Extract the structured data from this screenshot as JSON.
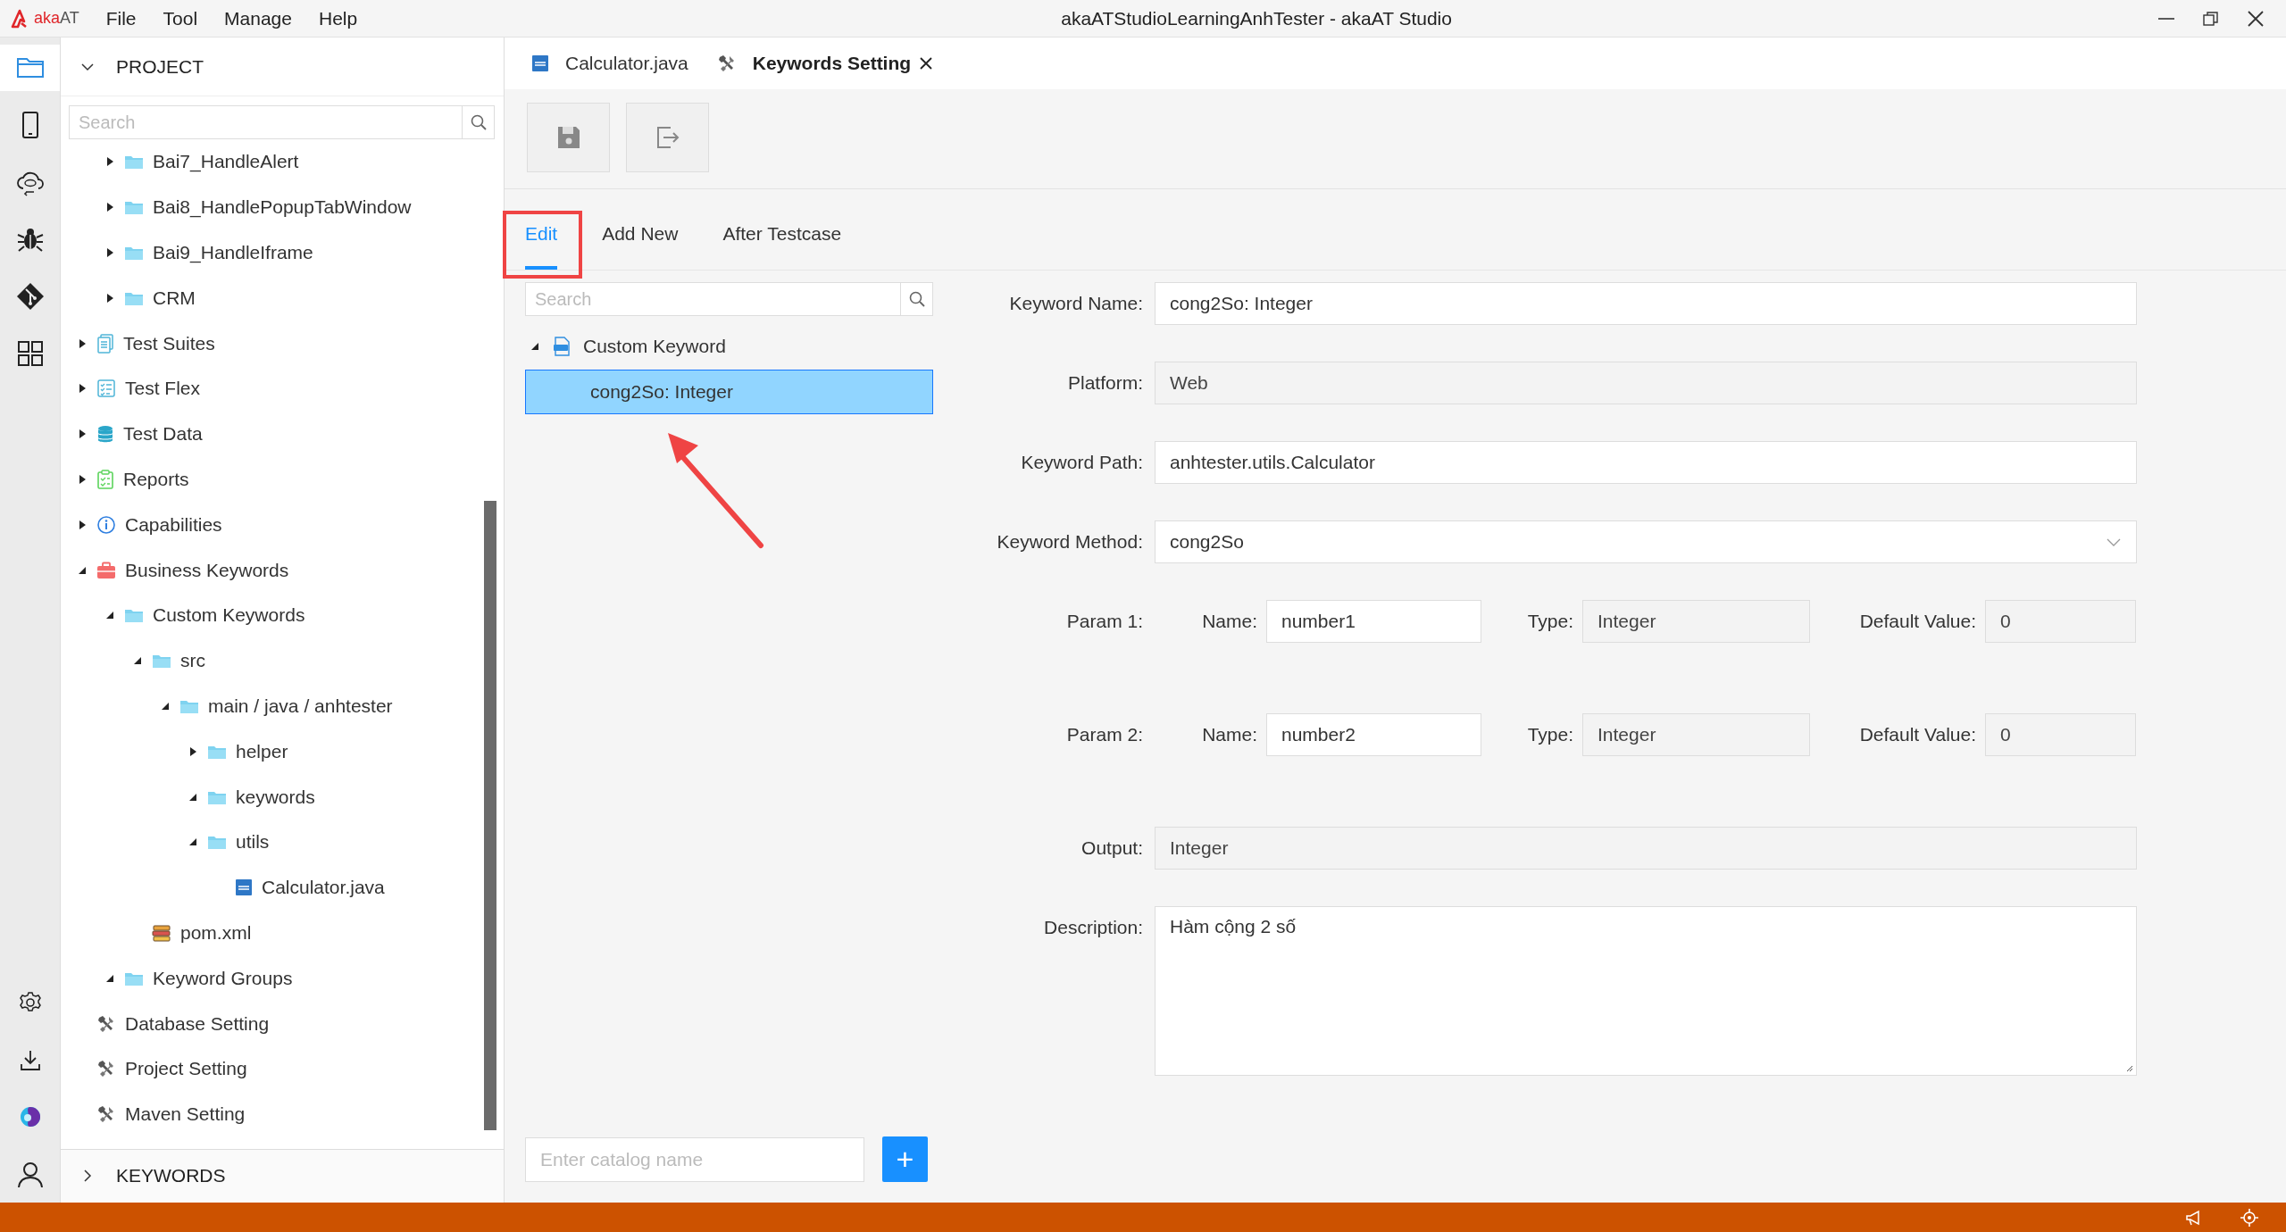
{
  "titlebar": {
    "logo": {
      "prefix": "aka",
      "suffix": "AT"
    },
    "menu": [
      "File",
      "Tool",
      "Manage",
      "Help"
    ],
    "title": "akaATStudioLearningAnhTester - akaAT Studio"
  },
  "activity_bar": {
    "top": [
      {
        "kind": "project",
        "selected": true
      },
      {
        "kind": "mobile",
        "selected": false
      },
      {
        "kind": "api",
        "selected": false
      },
      {
        "kind": "debug",
        "selected": false
      },
      {
        "kind": "git",
        "selected": false
      },
      {
        "kind": "apps",
        "selected": false
      }
    ],
    "bottom": [
      {
        "kind": "settings",
        "selected": false
      },
      {
        "kind": "download",
        "selected": false
      },
      {
        "kind": "brand",
        "selected": false
      },
      {
        "kind": "account",
        "selected": false
      }
    ]
  },
  "sidebar": {
    "header": "PROJECT",
    "expanded": true,
    "search": {
      "placeholder": "Search"
    },
    "tree": {
      "scrolled_group": [
        {
          "label": "Bai7_HandleAlert",
          "kind": "folder",
          "expanded": false
        },
        {
          "label": "Bai8_HandlePopupTabWindow",
          "kind": "folder",
          "expanded": false
        },
        {
          "label": "Bai9_HandleIframe",
          "kind": "folder",
          "expanded": false
        },
        {
          "label": "CRM",
          "kind": "folder",
          "expanded": false
        }
      ],
      "items": [
        {
          "label": "Test Suites",
          "kind": "test-suites",
          "expanded": false
        },
        {
          "label": "Test Flex",
          "kind": "test-flex",
          "expanded": false
        },
        {
          "label": "Test Data",
          "kind": "test-data",
          "expanded": false
        },
        {
          "label": "Reports",
          "kind": "reports",
          "expanded": false
        },
        {
          "label": "Capabilities",
          "kind": "capabilities",
          "expanded": false
        },
        {
          "label": "Business Keywords",
          "kind": "business-keywords",
          "expanded": true,
          "children": [
            {
              "label": "Custom Keywords",
              "kind": "folder",
              "expanded": true,
              "children": [
                {
                  "label": "src",
                  "kind": "folder",
                  "expanded": true,
                  "children": [
                    {
                      "label": "main / java / anhtester",
                      "kind": "folder",
                      "expanded": true,
                      "children": [
                        {
                          "label": "helper",
                          "kind": "folder",
                          "expanded": false
                        },
                        {
                          "label": "keywords",
                          "kind": "folder",
                          "expanded": true
                        },
                        {
                          "label": "utils",
                          "kind": "folder",
                          "expanded": true,
                          "children": [
                            {
                              "label": "Calculator.java",
                              "kind": "java-file"
                            }
                          ]
                        }
                      ]
                    }
                  ]
                },
                {
                  "label": "pom.xml",
                  "kind": "pom-file"
                }
              ]
            },
            {
              "label": "Keyword Groups",
              "kind": "folder",
              "expanded": true
            }
          ]
        },
        {
          "label": "Database Setting",
          "kind": "setting"
        },
        {
          "label": "Project Setting",
          "kind": "setting"
        },
        {
          "label": "Maven Setting",
          "kind": "setting"
        }
      ]
    },
    "footer": {
      "header": "KEYWORDS",
      "expanded": false
    }
  },
  "editor_tabs": [
    {
      "label": "Calculator.java",
      "kind": "java-file",
      "selected": false,
      "closable": false
    },
    {
      "label": "Keywords Setting",
      "kind": "setting",
      "selected": true,
      "closable": true
    }
  ],
  "toolbar": [
    {
      "kind": "save",
      "disabled": true
    },
    {
      "kind": "export",
      "disabled": true
    }
  ],
  "subtabs": [
    {
      "label": "Edit",
      "selected": true,
      "highlighted": true
    },
    {
      "label": "Add New",
      "selected": false,
      "highlighted": false
    },
    {
      "label": "After Testcase",
      "selected": false,
      "highlighted": false
    }
  ],
  "keyword_list": {
    "search": {
      "placeholder": "Search"
    },
    "groups": [
      {
        "label": "Custom Keyword",
        "expanded": true,
        "children": [
          {
            "label": "cong2So: Integer",
            "selected": true
          }
        ]
      }
    ]
  },
  "form": {
    "rows": [
      {
        "kind": "text",
        "label": "Keyword Name:",
        "value": "cong2So: Integer",
        "disabled": false
      },
      {
        "kind": "text",
        "label": "Platform:",
        "value": "Web",
        "disabled": true
      },
      {
        "kind": "text",
        "label": "Keyword Path:",
        "value": "anhtester.utils.Calculator",
        "disabled": false
      },
      {
        "kind": "select",
        "label": "Keyword Method:",
        "value": "cong2So",
        "disabled": false
      },
      {
        "kind": "param",
        "label": "Param 1:",
        "fields": [
          {
            "label": "Name:",
            "value": "number1",
            "disabled": false
          },
          {
            "label": "Type:",
            "value": "Integer",
            "disabled": true
          },
          {
            "label": "Default Value:",
            "value": "0",
            "disabled": true
          }
        ]
      },
      {
        "kind": "param",
        "label": "Param 2:",
        "fields": [
          {
            "label": "Name:",
            "value": "number2",
            "disabled": false
          },
          {
            "label": "Type:",
            "value": "Integer",
            "disabled": true
          },
          {
            "label": "Default Value:",
            "value": "0",
            "disabled": true
          }
        ]
      },
      {
        "kind": "text",
        "label": "Output:",
        "value": "Integer",
        "disabled": true
      },
      {
        "kind": "textarea",
        "label": "Description:",
        "value": "Hàm cộng 2 số",
        "disabled": false
      }
    ]
  },
  "catalog": {
    "placeholder": "Enter catalog name",
    "button": "+"
  }
}
